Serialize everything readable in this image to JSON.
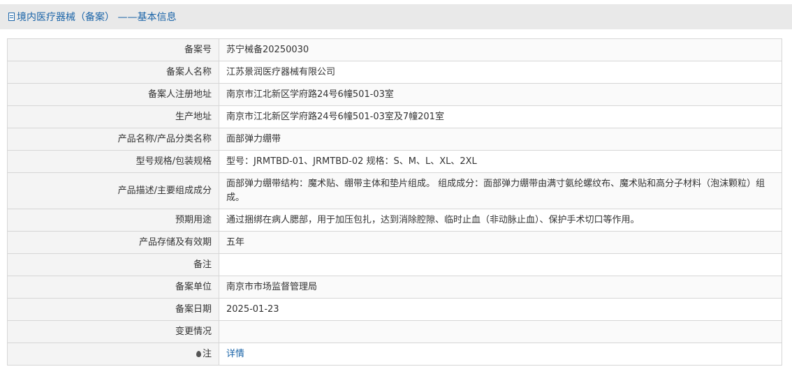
{
  "header": {
    "title": "境内医疗器械（备案） ——基本信息"
  },
  "rows": [
    {
      "label": "备案号",
      "value": "苏宁械备20250030"
    },
    {
      "label": "备案人名称",
      "value": "江苏景润医疗器械有限公司"
    },
    {
      "label": "备案人注册地址",
      "value": "南京市江北新区学府路24号6幢501-03室"
    },
    {
      "label": "生产地址",
      "value": "南京市江北新区学府路24号6幢501-03室及7幢201室"
    },
    {
      "label": "产品名称/产品分类名称",
      "value": "面部弹力绷带"
    },
    {
      "label": "型号规格/包装规格",
      "value": "型号：JRMTBD-01、JRMTBD-02 规格：S、M、L、XL、2XL"
    },
    {
      "label": "产品描述/主要组成成分",
      "value": "面部弹力绷带结构：魔术贴、绷带主体和垫片组成。 组成成分：面部弹力绷带由满寸氨纶螺纹布、魔术贴和高分子材料（泡沫颗粒）组成。"
    },
    {
      "label": "预期用途",
      "value": "通过捆绑在病人腮部，用于加压包扎，达到消除腔隙、临时止血（非动脉止血）、保护手术切口等作用。"
    },
    {
      "label": "产品存储及有效期",
      "value": "五年"
    },
    {
      "label": "备注",
      "value": ""
    },
    {
      "label": "备案单位",
      "value": "南京市市场监督管理局"
    },
    {
      "label": "备案日期",
      "value": "2025-01-23"
    },
    {
      "label": "变更情况",
      "value": ""
    },
    {
      "label": "注",
      "value": "详情"
    }
  ]
}
